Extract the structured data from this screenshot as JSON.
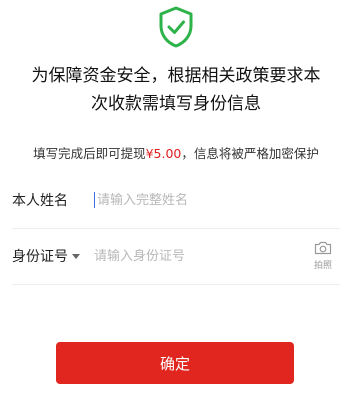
{
  "header": {
    "icon": "shield-check-icon",
    "accent_color": "#2db34a",
    "title_line1": "为保障资金安全，根据相关政策要求本",
    "title_line2": "次收款需填写身份信息"
  },
  "notice": {
    "prefix": "填写完成后即可提现",
    "amount": "¥5.00",
    "suffix": "，信息将被严格加密保护"
  },
  "form": {
    "name_label": "本人姓名",
    "name_placeholder": "请输入完整姓名",
    "id_label": "身份证号",
    "id_placeholder": "请输入身份证号",
    "camera_label": "拍照"
  },
  "confirm_button": "确定",
  "colors": {
    "button": "#e0261f",
    "amount": "#e02020"
  }
}
